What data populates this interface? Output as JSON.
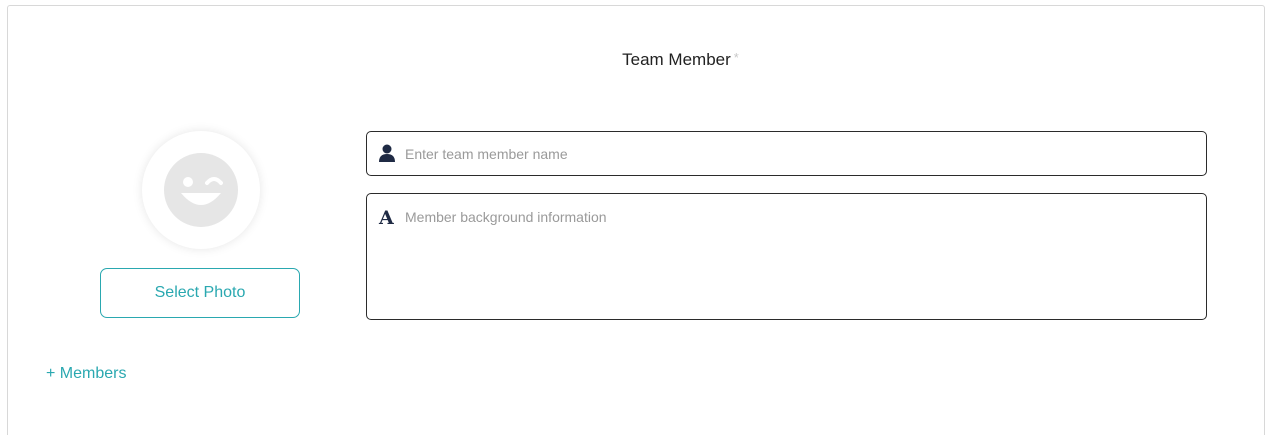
{
  "form": {
    "title": "Team Member",
    "required_mark": "*",
    "avatar_icon": "winking-face-icon",
    "select_photo_label": "Select Photo",
    "name_field": {
      "icon": "user-icon",
      "placeholder": "Enter team member name",
      "value": ""
    },
    "bio_field": {
      "icon": "text-a-icon",
      "icon_glyph": "A",
      "placeholder": "Member background information",
      "value": ""
    },
    "add_members_label": "+ Members"
  },
  "colors": {
    "accent": "#2aa8b0",
    "border": "#2b2b2b",
    "icon_dark": "#1f2a44",
    "avatar_face": "#e6e6e6"
  }
}
